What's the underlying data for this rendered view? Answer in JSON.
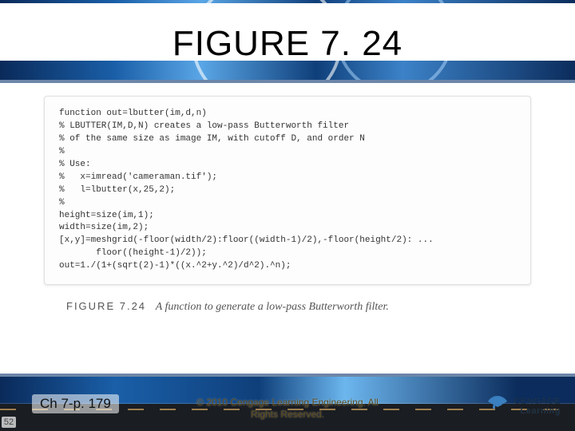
{
  "header": {
    "title": "FIGURE 7. 24"
  },
  "content": {
    "code": "function out=lbutter(im,d,n)\n% LBUTTER(IM,D,N) creates a low-pass Butterworth filter\n% of the same size as image IM, with cutoff D, and order N\n%\n% Use:\n%   x=imread('cameraman.tif');\n%   l=lbutter(x,25,2);\n%\nheight=size(im,1);\nwidth=size(im,2);\n[x,y]=meshgrid(-floor(width/2):floor((width-1)/2),-floor(height/2): ...\n       floor((height-1)/2));\nout=1./(1+(sqrt(2)-1)*((x.^2+y.^2)/d^2).^n);",
    "caption_label": "FIGURE 7.24",
    "caption_desc": "A function to generate a low-pass Butterworth filter."
  },
  "footer": {
    "slide_number": "52",
    "chapter_page": "Ch 7-p. 179",
    "copyright_line1": "© 2010 Cengage Learning Engineering. All",
    "copyright_line2": "Rights Reserved.",
    "logo_line1": "CENGAGE",
    "logo_line2": "Learning"
  }
}
